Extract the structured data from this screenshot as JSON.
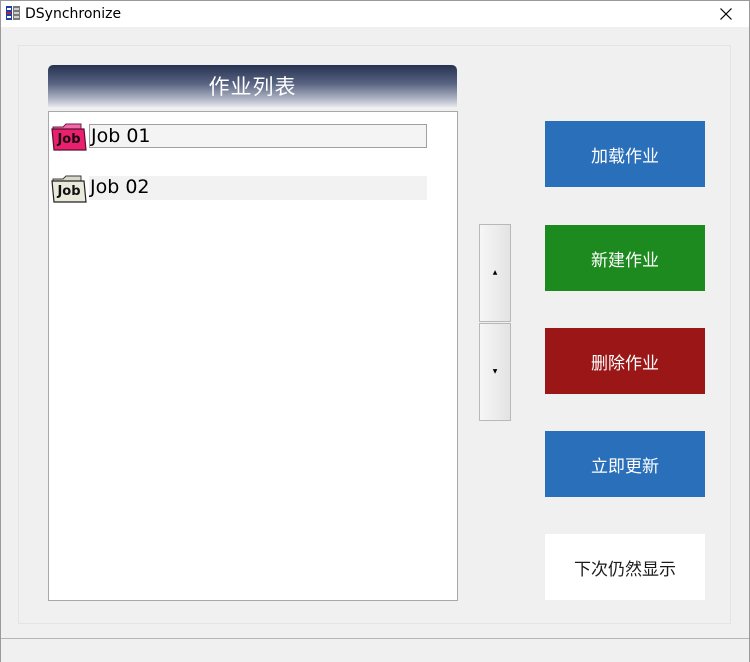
{
  "window": {
    "title": "DSynchronize"
  },
  "job_list": {
    "header": "作业列表",
    "items": [
      {
        "label": "Job 01",
        "selected": true,
        "icon": "job-folder-pink-icon",
        "icon_text": "Job"
      },
      {
        "label": "Job 02",
        "selected": false,
        "icon": "job-folder-gray-icon",
        "icon_text": "Job"
      }
    ]
  },
  "scroll": {
    "up_glyph": "▲",
    "down_glyph": "▼"
  },
  "actions": {
    "load": {
      "label": "加载作业",
      "color": "#2a6fba"
    },
    "new": {
      "label": "新建作业",
      "color": "#1c8a1e"
    },
    "delete": {
      "label": "删除作业",
      "color": "#9b1616"
    },
    "update": {
      "label": "立即更新",
      "color": "#2a6fba"
    },
    "show_next": {
      "label": "下次仍然显示",
      "color": "#ffffff"
    }
  }
}
